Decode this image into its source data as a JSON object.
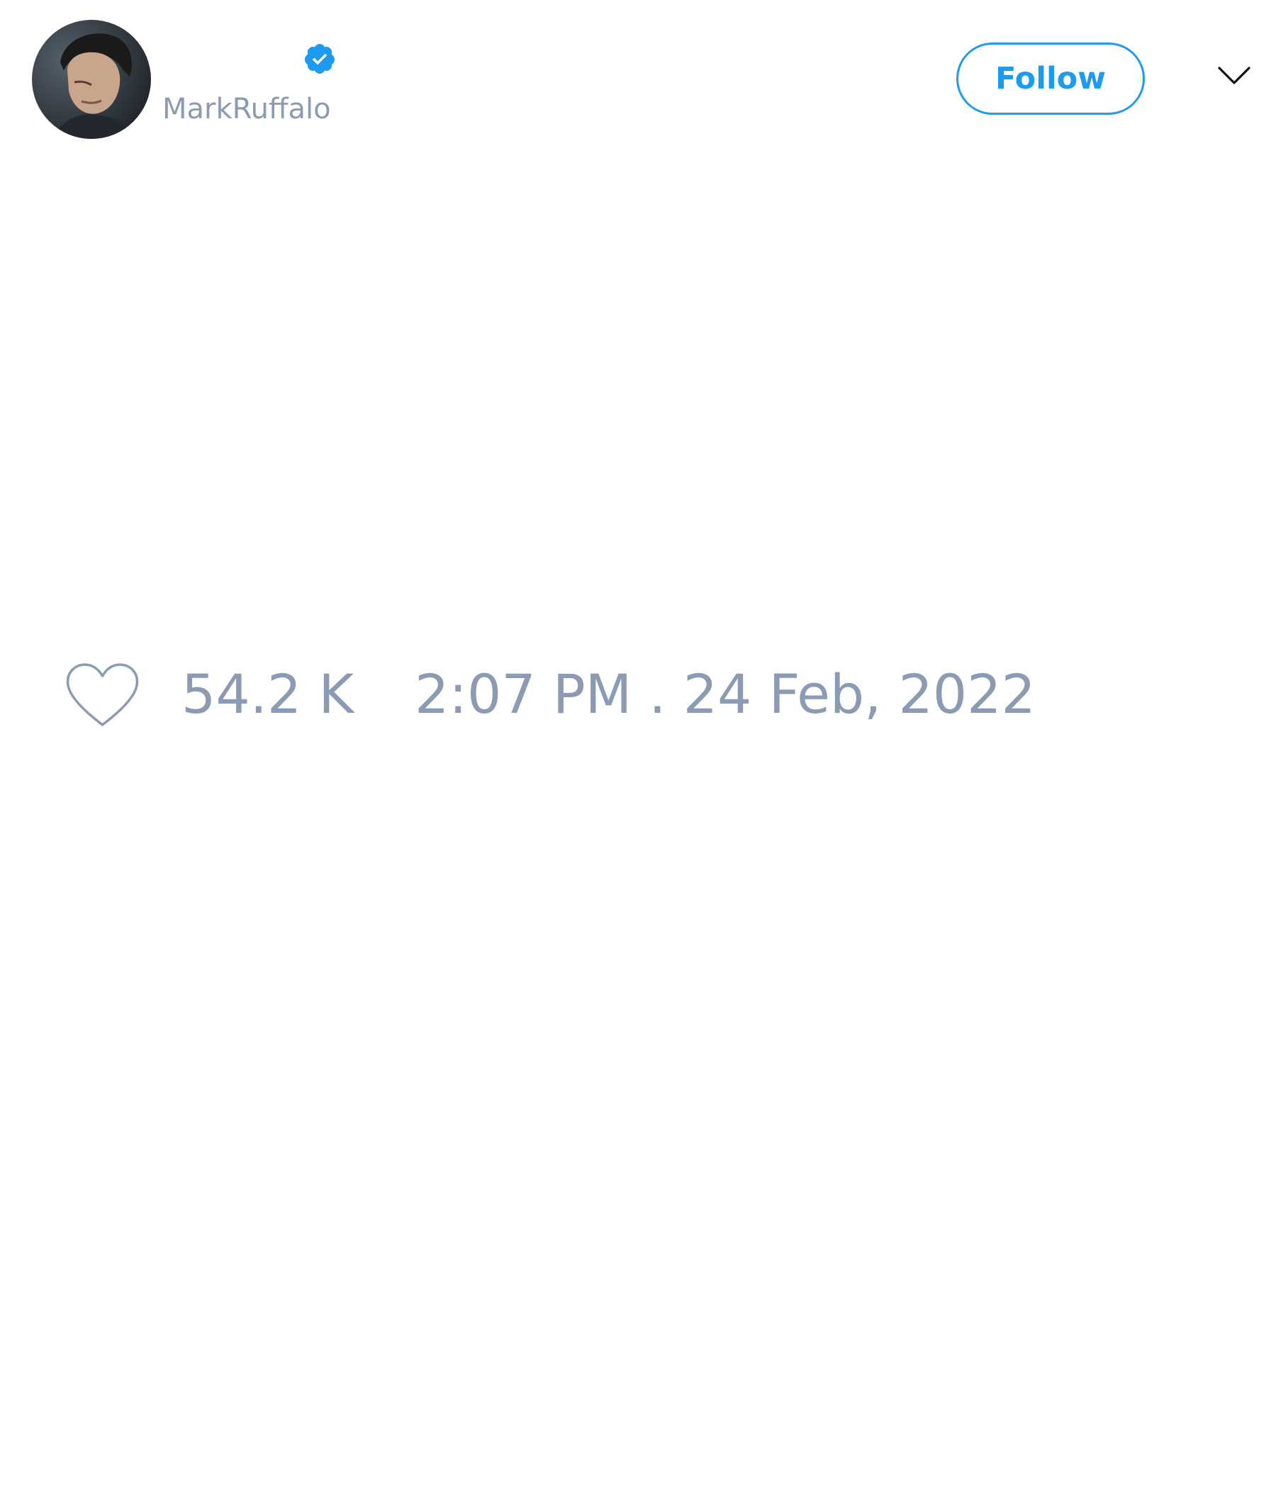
{
  "tweet": {
    "author": {
      "handle": "MarkRuffalo",
      "verified": true,
      "avatar": "profile-photo"
    },
    "follow_label": "Follow",
    "menu_icon": "chevron-down-icon",
    "likes": {
      "icon": "heart-outline-icon",
      "count": "54.2 K"
    },
    "timestamp": "2:07 PM . 24 Feb, 2022"
  },
  "colors": {
    "accent": "#1d9bf0",
    "muted_text": "#8b9bb4",
    "background": "#ffffff"
  }
}
